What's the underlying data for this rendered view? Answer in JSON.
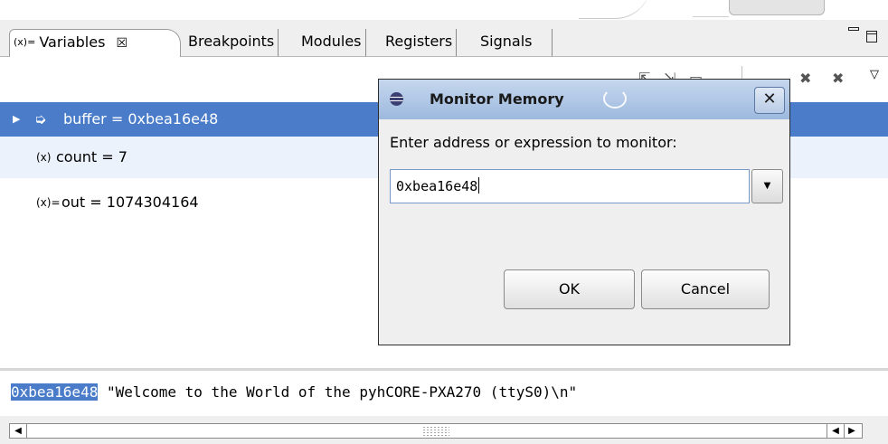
{
  "tabs": {
    "variables": "Variables",
    "variables_icon": "(x)=",
    "close_glyph": "☒",
    "breakpoints": "Breakpoints",
    "modules": "Modules",
    "registers": "Registers",
    "signals": "Signals"
  },
  "variables": [
    {
      "expression": "buffer = 0xbea16e48",
      "icon": "pointer-variable-icon",
      "selected": true,
      "expandable": true
    },
    {
      "expression": "count = 7",
      "icon": "local-variable-icon",
      "selected": false,
      "expandable": false
    },
    {
      "expression": "out = 1074304164",
      "icon": "variable-icon",
      "selected": false,
      "expandable": false
    }
  ],
  "detail": {
    "address": "0xbea16e48",
    "value": " \"Welcome to the World of the pyhCORE-PXA270 (ttyS0)\\n\""
  },
  "dialog": {
    "title": "Monitor Memory",
    "prompt": "Enter address or expression to monitor:",
    "input_value": "0xbea16e48",
    "ok_label": "OK",
    "cancel_label": "Cancel",
    "close_label": "✕"
  },
  "colors": {
    "selection": "#4a7cc9",
    "row_alt": "#ecf2fb",
    "dialog_title": "#9db9de"
  }
}
